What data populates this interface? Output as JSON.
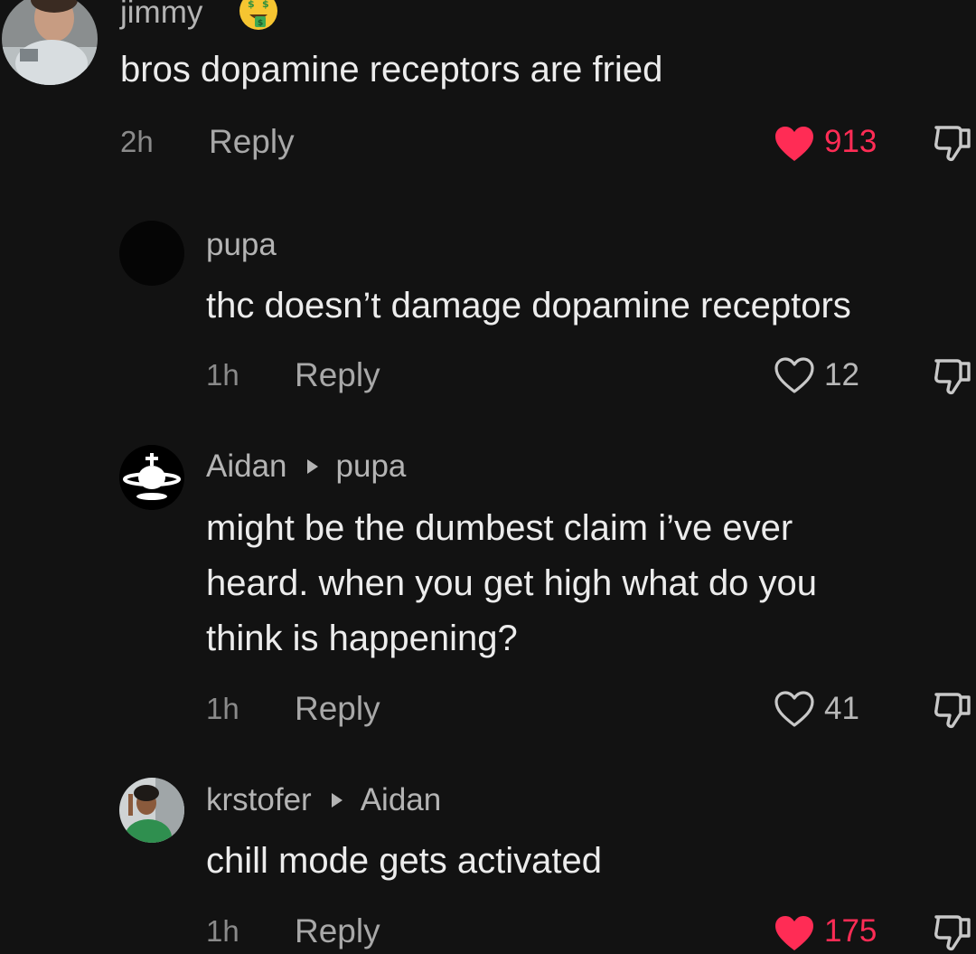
{
  "comments": [
    {
      "username": "jimmy",
      "text": "bros dopamine receptors are fried",
      "time": "2h",
      "reply_label": "Reply",
      "likes": "913",
      "liked": true
    },
    {
      "username": "pupa",
      "text": "thc doesn’t damage dopamine receptors",
      "time": "1h",
      "reply_label": "Reply",
      "likes": "12",
      "liked": false
    },
    {
      "username": "Aidan",
      "reply_to": "pupa",
      "text": "might be the dumbest claim i’ve ever\nheard. when you get high what do you\nthink is happening?",
      "time": "1h",
      "reply_label": "Reply",
      "likes": "41",
      "liked": false
    },
    {
      "username": "krstofer",
      "reply_to": "Aidan",
      "text": "chill mode gets activated",
      "time": "1h",
      "reply_label": "Reply",
      "likes": "175",
      "liked": true
    }
  ],
  "icons": {
    "like": "heart-icon",
    "dislike": "thumbs-down-icon",
    "reply_arrow": "triangle-right-icon",
    "emoji": "money-mouth-face-emoji"
  },
  "colors": {
    "background": "#121212",
    "liked": "#ff2c55",
    "text_primary": "#ececec",
    "text_secondary": "#b4b4b4"
  }
}
